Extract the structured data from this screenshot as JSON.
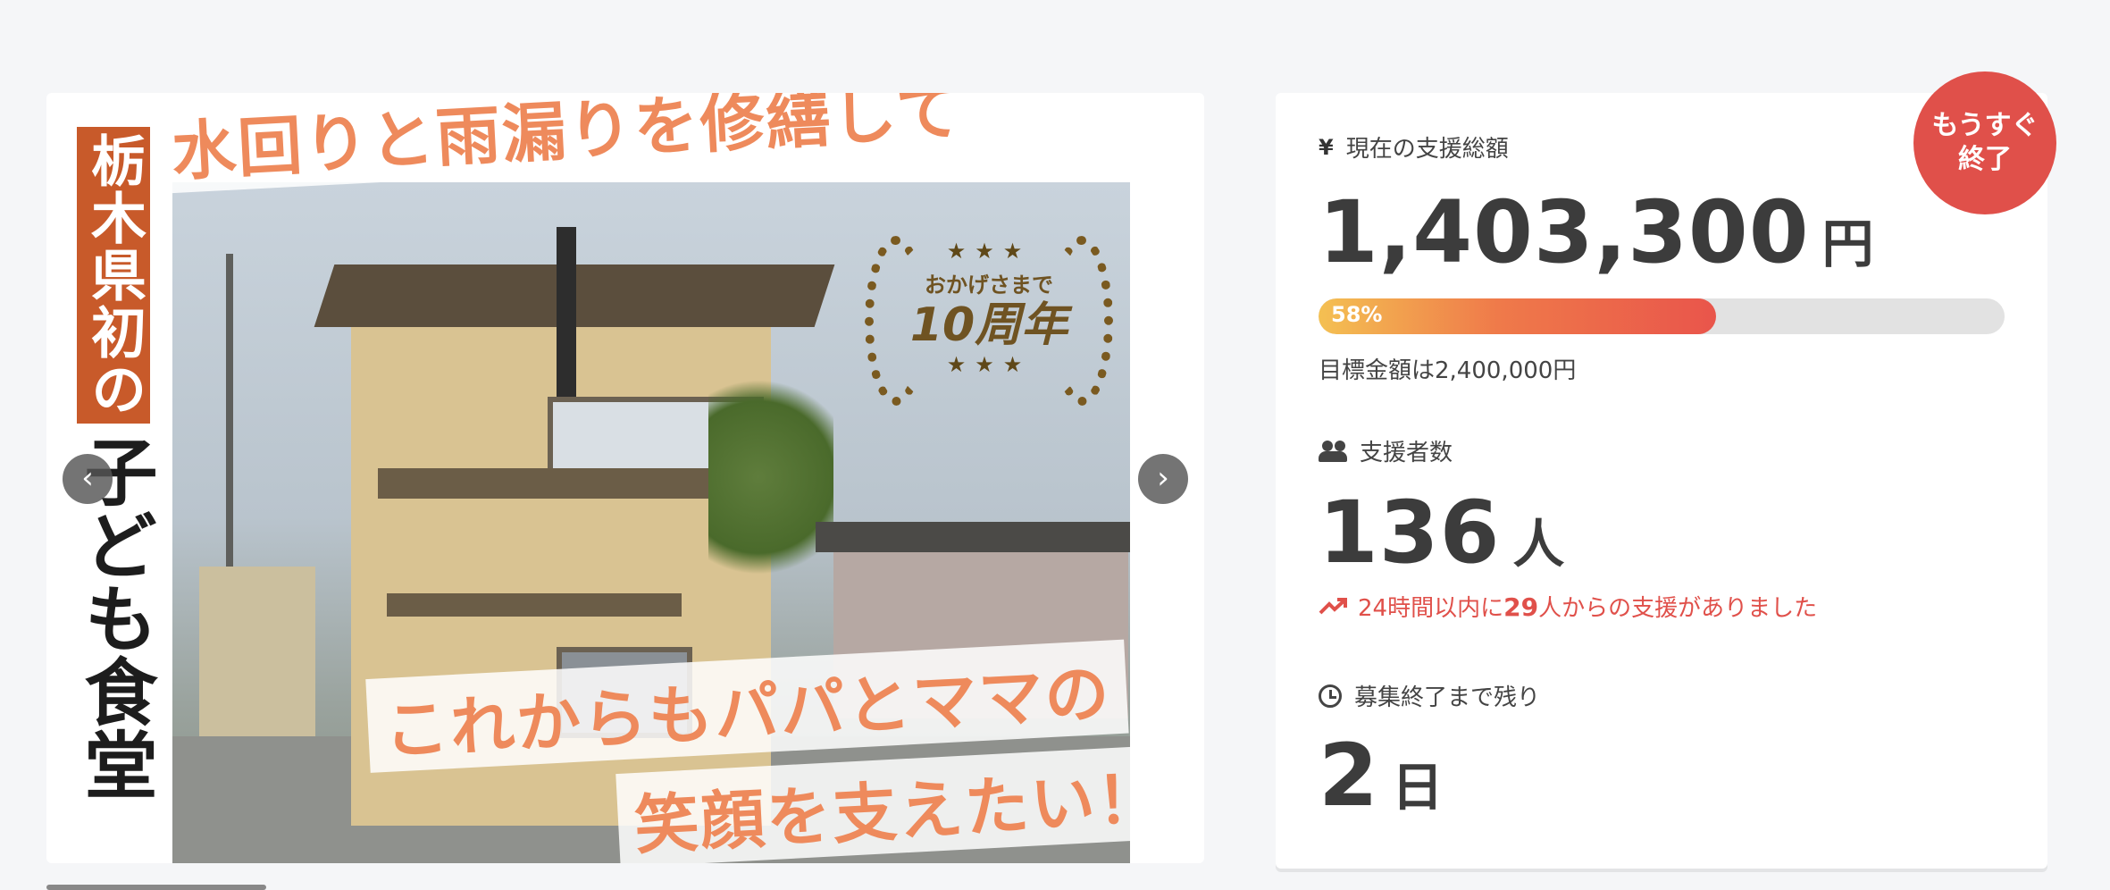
{
  "hero": {
    "side_title_top": "栃木県初の",
    "side_title_bottom": "子ども食堂",
    "headline_top": "水回りと雨漏りを修繕して",
    "headline_bottom_1": "これからもパパとママの",
    "headline_bottom_2": "笑顔を支えたい！",
    "badge_small": "おかげさまで",
    "badge_big": "10周年",
    "badge_stars": "★★★",
    "prev_label": "‹",
    "next_label": "›"
  },
  "stats": {
    "ending_badge": [
      "もうすぐ",
      "終了"
    ],
    "total": {
      "label": "現在の支援総額",
      "icon": "yen-icon",
      "value": "1,403,300",
      "unit": "円",
      "progress_percent": 58,
      "progress_label": "58%",
      "goal_text": "目標金額は2,400,000円"
    },
    "supporters": {
      "label": "支援者数",
      "icon": "people-icon",
      "value": "136",
      "unit": "人",
      "trend_prefix": "24時間以内に",
      "trend_count": "29",
      "trend_suffix": "人からの支援がありました",
      "trend_color": "#e0504a"
    },
    "remaining": {
      "label": "募集終了まで残り",
      "icon": "clock-icon",
      "value": "2",
      "unit": "日"
    }
  }
}
